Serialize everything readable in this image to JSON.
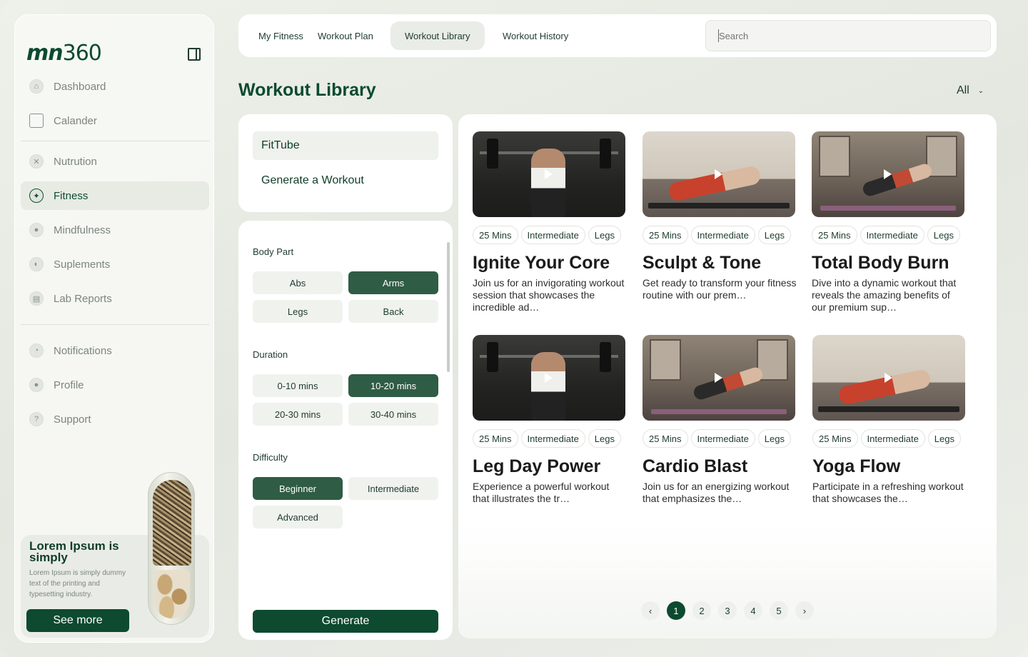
{
  "brand": {
    "logo_text": "mn",
    "logo_num": "360"
  },
  "sidebar": {
    "items": [
      {
        "label": "Dashboard",
        "icon": "home-icon"
      },
      {
        "label": "Calander",
        "icon": "calendar-icon"
      },
      {
        "label": "Nutrution",
        "icon": "nutrition-icon"
      },
      {
        "label": "Fitness",
        "icon": "running-icon",
        "active": true
      },
      {
        "label": "Mindfulness",
        "icon": "meditation-icon"
      },
      {
        "label": "Suplements",
        "icon": "pill-icon"
      },
      {
        "label": "Lab Reports",
        "icon": "report-icon"
      },
      {
        "label": "Notifications",
        "icon": "bell-icon"
      },
      {
        "label": "Profile",
        "icon": "user-icon"
      },
      {
        "label": "Support",
        "icon": "help-icon"
      }
    ],
    "promo": {
      "title": "Lorem Ipsum is simply",
      "text": "Lorem Ipsum is simply dummy text of the printing and typesetting industry.",
      "button": "See more"
    }
  },
  "topbar": {
    "tabs": [
      {
        "label": "My Fitness"
      },
      {
        "label": "Workout Plan"
      },
      {
        "label": "Workout Library",
        "active": true
      },
      {
        "label": "Workout History"
      }
    ],
    "search_placeholder": "Search"
  },
  "page": {
    "title": "Workout Library",
    "filter_value": "All"
  },
  "left_panel": {
    "fittube": "FitTube",
    "generate_workout": "Generate a Workout",
    "body_part": {
      "label": "Body Part",
      "options": [
        "Abs",
        "Arms",
        "Legs",
        "Back"
      ],
      "selected": "Arms"
    },
    "duration": {
      "label": "Duration",
      "options": [
        "0-10 mins",
        "10-20 mins",
        "20-30 mins",
        "30-40 mins"
      ],
      "selected": "10-20 mins"
    },
    "difficulty": {
      "label": "Difficulty",
      "options": [
        "Beginner",
        "Intermediate",
        "Advanced"
      ],
      "selected": "Beginner"
    },
    "generate_button": "Generate"
  },
  "cards": [
    {
      "duration": "25 Mins",
      "level": "Intermediate",
      "body": "Legs",
      "title": "Ignite Your Core",
      "desc": "Join us for an invigorating workout session that showcases the incredible ad…"
    },
    {
      "duration": "25 Mins",
      "level": "Intermediate",
      "body": "Legs",
      "title": "Sculpt & Tone",
      "desc": "Get ready to transform your fitness routine with our prem…"
    },
    {
      "duration": "25 Mins",
      "level": "Intermediate",
      "body": "Legs",
      "title": "Total Body Burn",
      "desc": "Dive into a dynamic workout that reveals the amazing benefits of our premium sup…"
    },
    {
      "duration": "25 Mins",
      "level": "Intermediate",
      "body": "Legs",
      "title": "Leg Day Power",
      "desc": "Experience a powerful workout that illustrates the tr…"
    },
    {
      "duration": "25 Mins",
      "level": "Intermediate",
      "body": "Legs",
      "title": "Cardio Blast",
      "desc": "Join us for an energizing workout that emphasizes the…"
    },
    {
      "duration": "25 Mins",
      "level": "Intermediate",
      "body": "Legs",
      "title": "Yoga Flow",
      "desc": "Participate in a refreshing workout that showcases the…"
    }
  ],
  "pagination": {
    "prev": "‹",
    "pages": [
      "1",
      "2",
      "3",
      "4",
      "5"
    ],
    "current": "1",
    "next": "›"
  },
  "colors": {
    "primary": "#0d4a2f",
    "chip_selected": "#2f5c44",
    "background": "#e5e9e2"
  }
}
